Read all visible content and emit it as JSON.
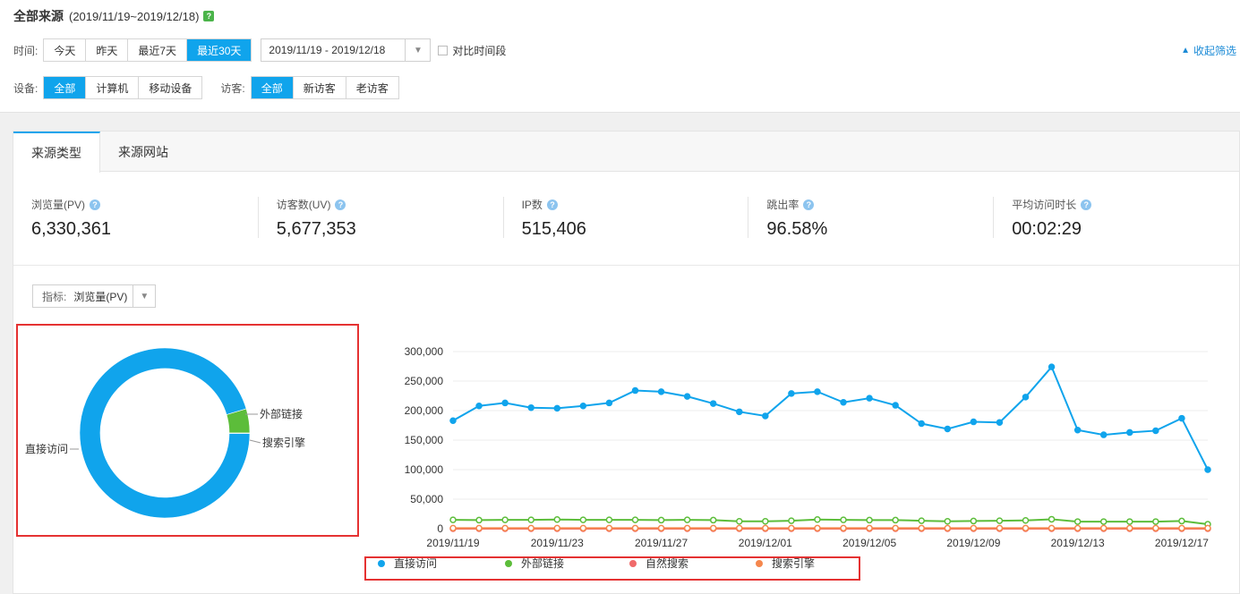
{
  "header": {
    "title": "全部来源",
    "range": "(2019/11/19~2019/12/18)",
    "help": "?"
  },
  "filters": {
    "time_label": "时间:",
    "time_buttons": [
      "今天",
      "昨天",
      "最近7天",
      "最近30天"
    ],
    "time_active": "最近30天",
    "date_range": "2019/11/19 - 2019/12/18",
    "compare_label": "对比时间段",
    "collapse_label": "收起筛选",
    "device_label": "设备:",
    "device_buttons": [
      "全部",
      "计算机",
      "移动设备"
    ],
    "device_active": "全部",
    "visitor_label": "访客:",
    "visitor_buttons": [
      "全部",
      "新访客",
      "老访客"
    ],
    "visitor_active": "全部"
  },
  "tabs": [
    "来源类型",
    "来源网站"
  ],
  "metrics": [
    {
      "label": "浏览量(PV)",
      "value": "6,330,361"
    },
    {
      "label": "访客数(UV)",
      "value": "5,677,353"
    },
    {
      "label": "IP数",
      "value": "515,406"
    },
    {
      "label": "跳出率",
      "value": "96.58%"
    },
    {
      "label": "平均访问时长",
      "value": "00:02:29"
    }
  ],
  "indicator": {
    "label": "指标:",
    "value": "浏览量(PV)"
  },
  "colors": {
    "direct": "#10a4ec",
    "external": "#5cbd3a",
    "natural": "#f06a6a",
    "engine": "#f5874d",
    "accent": "#10a4ec",
    "highlight": "#e53232"
  },
  "chart_data": [
    {
      "type": "pie",
      "donut": true,
      "labels": [
        "直接访问",
        "外部链接",
        "搜索引擎"
      ],
      "values": [
        0.953,
        0.046,
        0.001
      ]
    },
    {
      "type": "line",
      "ylim": [
        0,
        300000
      ],
      "yticks": [
        "0",
        "50,000",
        "100,000",
        "150,000",
        "200,000",
        "250,000",
        "300,000"
      ],
      "x": [
        "2019/11/19",
        "2019/11/20",
        "2019/11/21",
        "2019/11/22",
        "2019/11/23",
        "2019/11/24",
        "2019/11/25",
        "2019/11/26",
        "2019/11/27",
        "2019/11/28",
        "2019/11/29",
        "2019/11/30",
        "2019/12/01",
        "2019/12/02",
        "2019/12/03",
        "2019/12/04",
        "2019/12/05",
        "2019/12/06",
        "2019/12/07",
        "2019/12/08",
        "2019/12/09",
        "2019/12/10",
        "2019/12/11",
        "2019/12/12",
        "2019/12/13",
        "2019/12/14",
        "2019/12/15",
        "2019/12/16",
        "2019/12/17",
        "2019/12/18"
      ],
      "xtick_labels": [
        "2019/11/19",
        "2019/11/23",
        "2019/11/27",
        "2019/12/01",
        "2019/12/05",
        "2019/12/09",
        "2019/12/13",
        "2019/12/17"
      ],
      "series": [
        {
          "name": "直接访问",
          "color": "#10a4ec",
          "values": [
            183000,
            208000,
            213000,
            205000,
            204000,
            208000,
            213000,
            234000,
            232000,
            224000,
            212000,
            198000,
            191000,
            229000,
            232000,
            214000,
            221000,
            209000,
            178000,
            169000,
            181000,
            180000,
            223000,
            274000,
            167000,
            159000,
            163000,
            166000,
            187000,
            100000
          ]
        },
        {
          "name": "外部链接",
          "color": "#5cbd3a",
          "values": [
            15000,
            14500,
            15000,
            15000,
            15500,
            15000,
            15000,
            15000,
            14500,
            15000,
            14500,
            12500,
            12500,
            13500,
            15500,
            15000,
            14500,
            14500,
            13500,
            12500,
            13000,
            13500,
            14000,
            16000,
            12000,
            12000,
            12000,
            12000,
            13000,
            7500
          ]
        },
        {
          "name": "自然搜索",
          "color": "#f06a6a",
          "values": [
            0,
            0,
            0,
            0,
            0,
            0,
            0,
            0,
            0,
            0,
            0,
            0,
            0,
            0,
            0,
            0,
            0,
            0,
            0,
            0,
            0,
            0,
            0,
            0,
            0,
            0,
            0,
            0,
            0,
            0
          ]
        },
        {
          "name": "搜索引擎",
          "color": "#f5874d",
          "values": [
            1000,
            1000,
            1000,
            1000,
            1000,
            1000,
            1000,
            1000,
            1000,
            1000,
            1000,
            1000,
            1000,
            1000,
            1000,
            1000,
            1000,
            1000,
            1000,
            1000,
            1000,
            1000,
            1000,
            1000,
            1000,
            1000,
            1000,
            1000,
            1000,
            1000
          ]
        }
      ]
    }
  ]
}
